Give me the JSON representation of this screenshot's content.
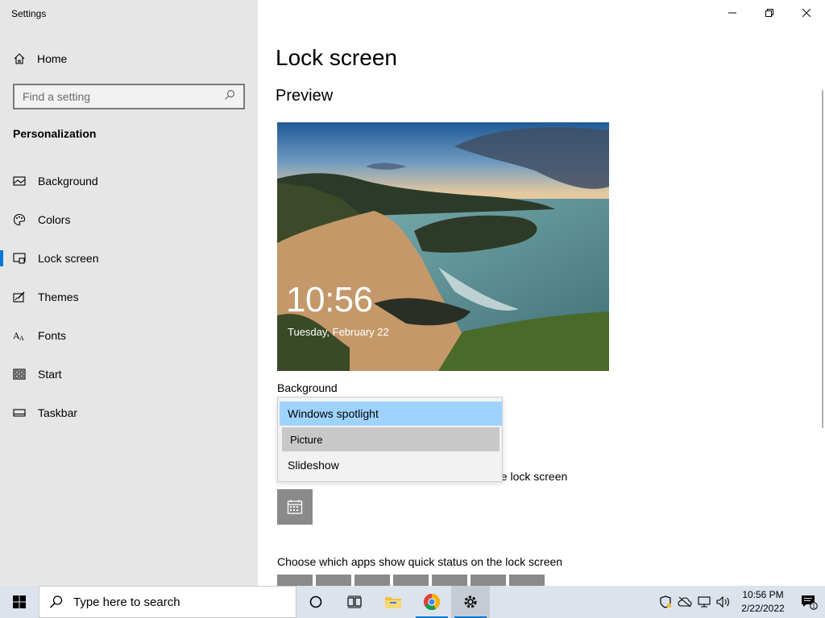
{
  "window": {
    "title": "Settings",
    "controls": [
      "minimize",
      "restore",
      "close"
    ]
  },
  "sidebar": {
    "home_label": "Home",
    "search_placeholder": "Find a setting",
    "section": "Personalization",
    "items": [
      {
        "label": "Background",
        "icon": "picture-icon"
      },
      {
        "label": "Colors",
        "icon": "palette-icon"
      },
      {
        "label": "Lock screen",
        "icon": "lock-screen-icon",
        "active": true
      },
      {
        "label": "Themes",
        "icon": "themes-icon"
      },
      {
        "label": "Fonts",
        "icon": "fonts-icon"
      },
      {
        "label": "Start",
        "icon": "start-icon"
      },
      {
        "label": "Taskbar",
        "icon": "taskbar-icon"
      }
    ]
  },
  "main": {
    "title": "Lock screen",
    "preview_heading": "Preview",
    "preview": {
      "time": "10:56",
      "date": "Tuesday, February 22"
    },
    "background_label": "Background",
    "dropdown": {
      "options": [
        "Windows spotlight",
        "Picture",
        "Slideshow"
      ],
      "selected": "Windows spotlight",
      "hovered": "Picture"
    },
    "detailed_status_tail": "he lock screen",
    "quick_status_label": "Choose which apps show quick status on the lock screen"
  },
  "taskbar": {
    "search_placeholder": "Type here to search",
    "apps": [
      "cortana-icon",
      "task-view-icon",
      "file-explorer-icon",
      "chrome-icon",
      "settings-icon"
    ],
    "clock_time": "10:56 PM",
    "clock_date": "2/22/2022",
    "notification_count": "1"
  },
  "colors": {
    "accent": "#0078d7",
    "sidebar_bg": "#e6e6e6",
    "dropdown_selected": "#9fd3ff",
    "dropdown_hover": "#c8c8c8",
    "taskbar_bg": "#dce3ec"
  }
}
